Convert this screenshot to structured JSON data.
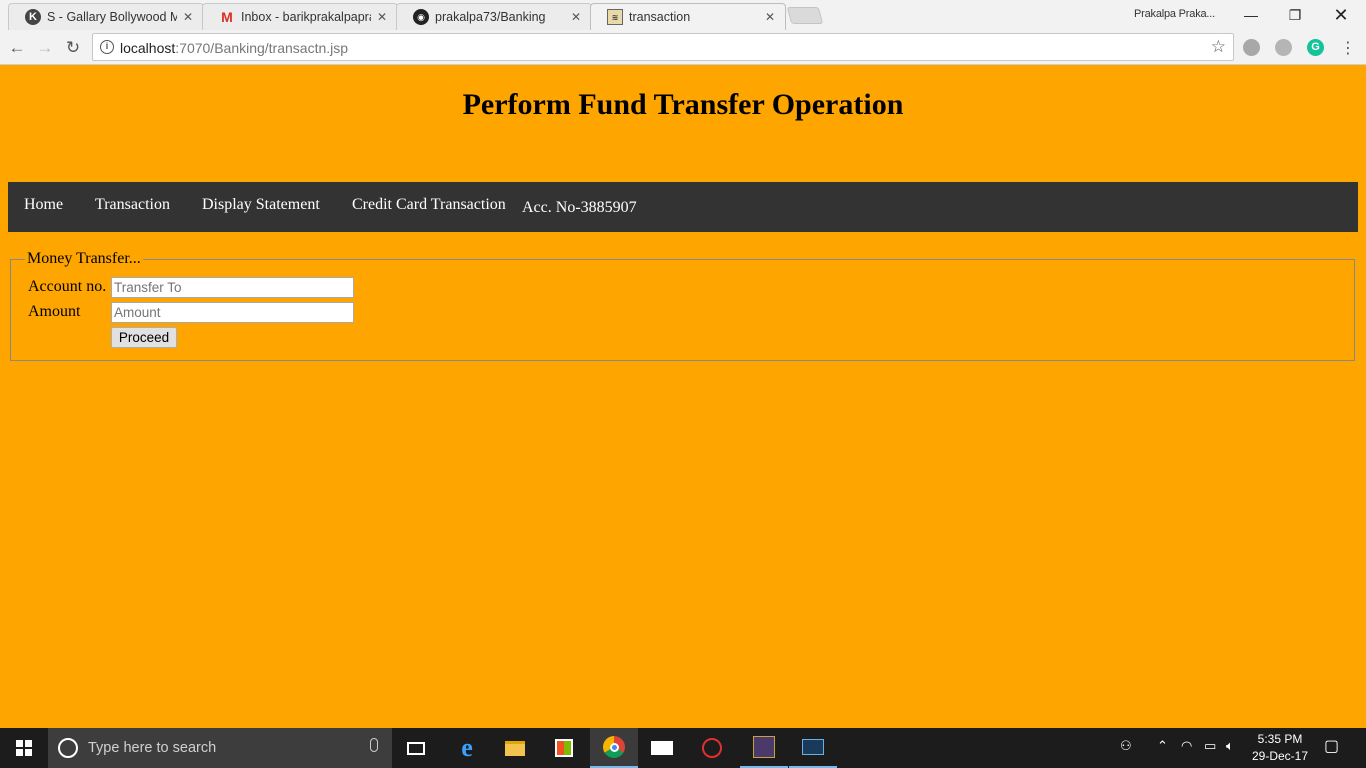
{
  "browser": {
    "tabs": [
      {
        "title": "S - Gallary Bollywood Mo",
        "icon": "k-site-icon",
        "active": false
      },
      {
        "title": "Inbox - barikprakalpaprak",
        "icon": "gmail-icon",
        "active": false
      },
      {
        "title": "prakalpa73/Banking",
        "icon": "github-icon",
        "active": false
      },
      {
        "title": "transaction",
        "icon": "page-icon",
        "active": true
      }
    ],
    "profile_name": "Prakalpa Praka...",
    "url_host": "localhost",
    "url_path": ":7070/Banking/transactn.jsp"
  },
  "page": {
    "heading": "Perform Fund Transfer Operation",
    "nav": {
      "items": [
        "Home",
        "Transaction",
        "Display Statement",
        "Credit Card Transaction"
      ],
      "account_label": "Acc. No-3885907"
    },
    "form": {
      "legend": "Money Transfer...",
      "account_label": "Account no.",
      "account_placeholder": "Transfer To",
      "amount_label": "Amount",
      "amount_placeholder": "Amount",
      "submit_label": "Proceed"
    },
    "background_color": "#ffa500",
    "nav_color": "#333333"
  },
  "taskbar": {
    "search_placeholder": "Type here to search",
    "time": "5:35 PM",
    "date": "29-Dec-17"
  }
}
